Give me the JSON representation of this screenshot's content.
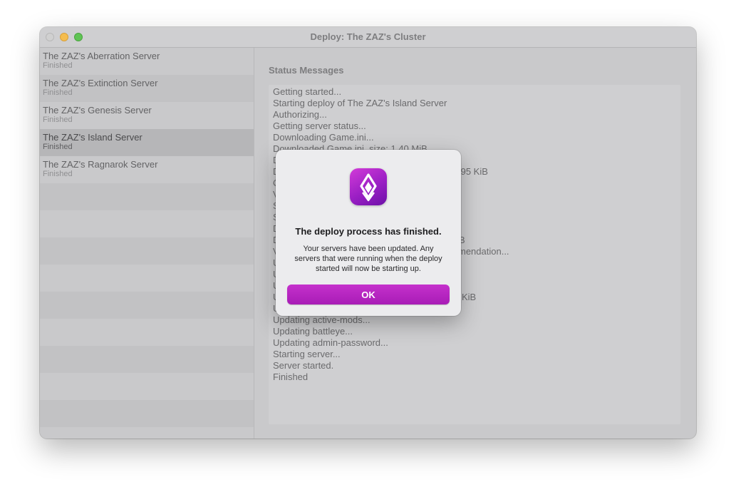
{
  "window": {
    "title": "Deploy: The ZAZ's Cluster"
  },
  "sidebar": {
    "items": [
      {
        "name": "The ZAZ's Aberration Server",
        "status": "Finished"
      },
      {
        "name": "The ZAZ's Extinction Server",
        "status": "Finished"
      },
      {
        "name": "The ZAZ's Genesis Server",
        "status": "Finished"
      },
      {
        "name": "The ZAZ's Island Server",
        "status": "Finished",
        "selected": true
      },
      {
        "name": "The ZAZ's Ragnarok Server",
        "status": "Finished"
      }
    ]
  },
  "main": {
    "section_title": "Status Messages",
    "log": [
      "Getting started...",
      "Starting deploy of The ZAZ's Island Server",
      "Authorizing...",
      "Getting server status...",
      "Downloading Game.ini...",
      "Downloaded Game.ini, size: 1.40 MiB",
      "D",
      "D",
      "C",
      "V",
      "S",
      "S",
      "D",
      "D",
      "V",
      "U",
      "U",
      "U",
      "U",
      "U",
      "Updating active-mods...",
      "Updating battleye...",
      "Updating admin-password...",
      "Starting server...",
      "Server started.",
      "Finished"
    ],
    "log_fragments": [
      {
        "line": 7,
        "text": ".95 KiB"
      },
      {
        "line": 13,
        "text": "B"
      },
      {
        "line": 14,
        "text": "mendation..."
      },
      {
        "line": 18,
        "text": "KiB"
      }
    ]
  },
  "dialog": {
    "icon": "app-icon",
    "title": "The deploy process has finished.",
    "message": "Your servers have been updated. Any servers that were running when the deploy started will now be starting up.",
    "ok_label": "OK",
    "accent_color": "#b224c0"
  }
}
